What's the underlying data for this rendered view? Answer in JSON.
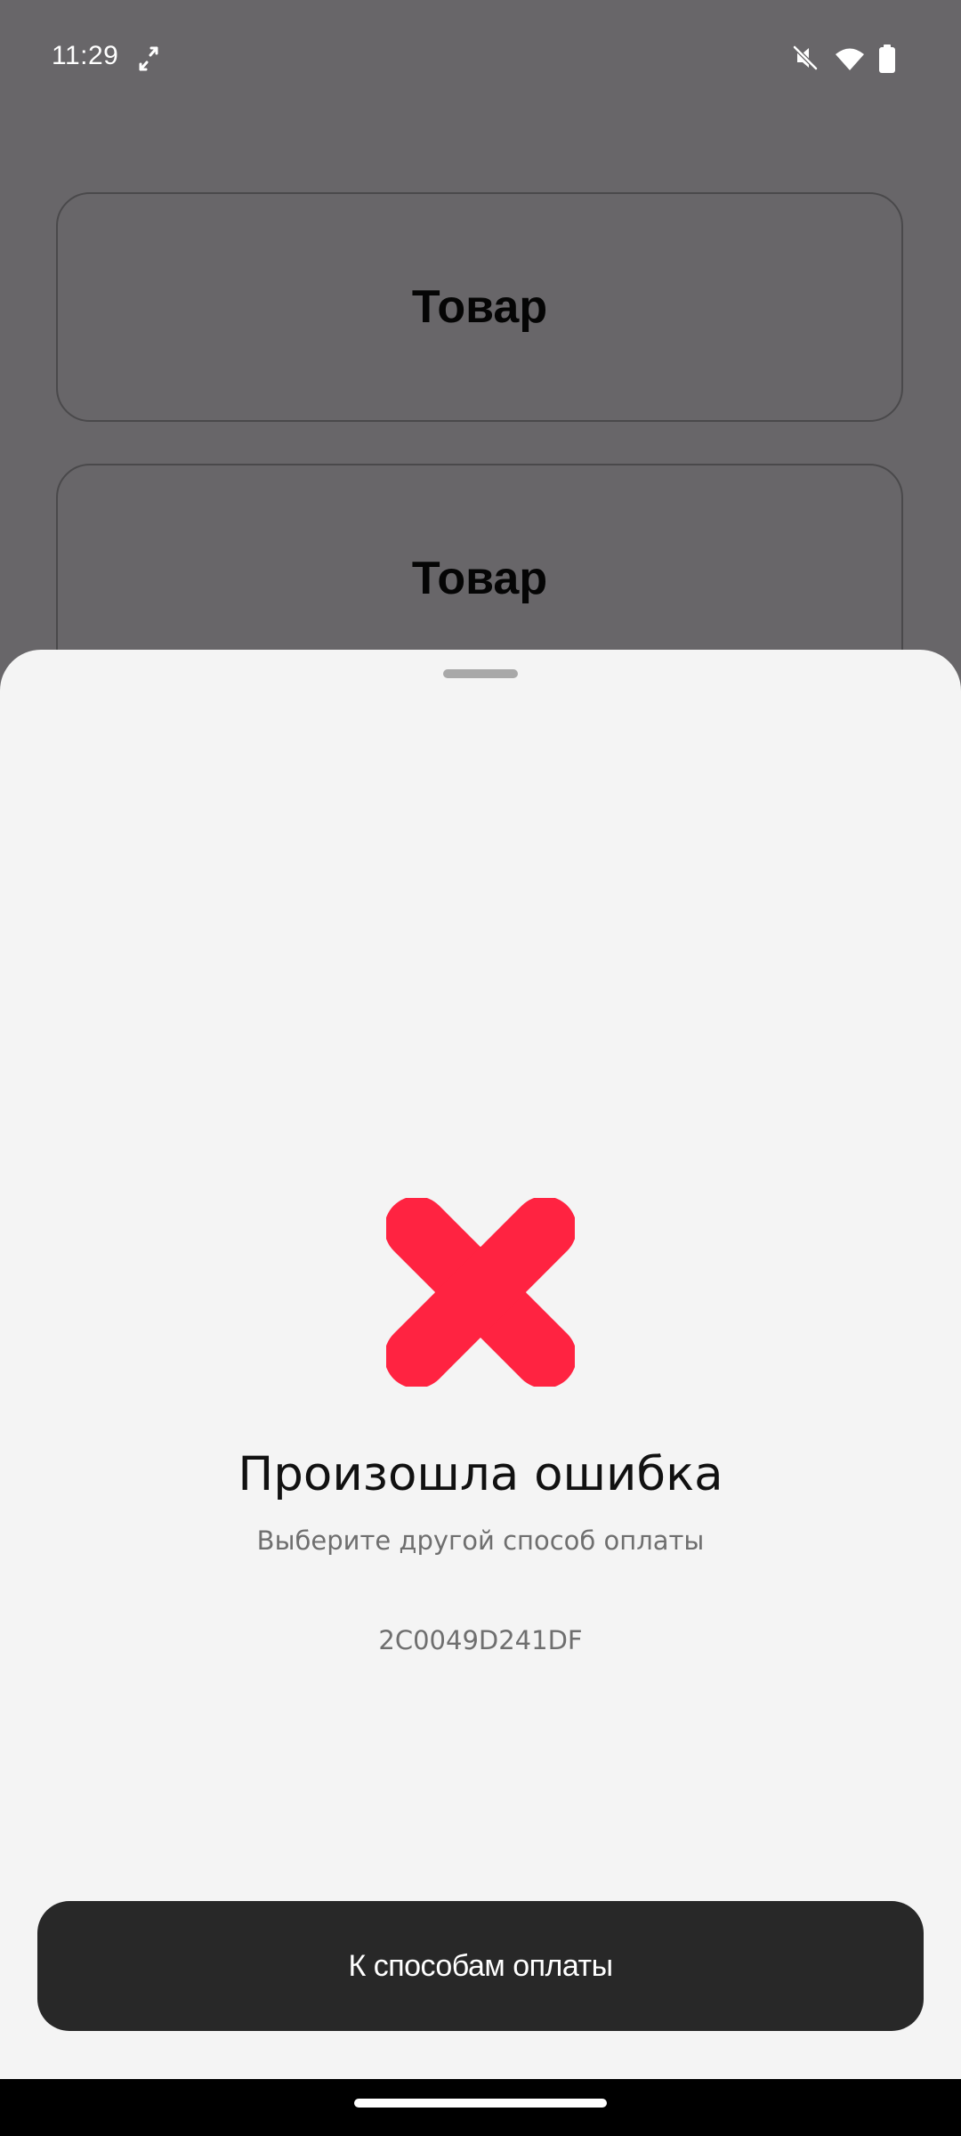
{
  "status_bar": {
    "time": "11:29",
    "icons": [
      "screen-rotate-icon",
      "vibrate-off-icon",
      "wifi-icon",
      "battery-icon"
    ]
  },
  "products": [
    {
      "title": "Товар"
    },
    {
      "title": "Товар"
    }
  ],
  "sheet": {
    "icon": "error-cross-icon",
    "icon_color": "#ff2341",
    "title": "Произошла ошибка",
    "subtitle": "Выберите другой способ оплаты",
    "error_code": "2C0049D241DF",
    "button_label": "К способам оплаты"
  },
  "colors": {
    "overlay_background": "#686669",
    "sheet_background": "#f4f4f4",
    "button_background": "#282828"
  }
}
